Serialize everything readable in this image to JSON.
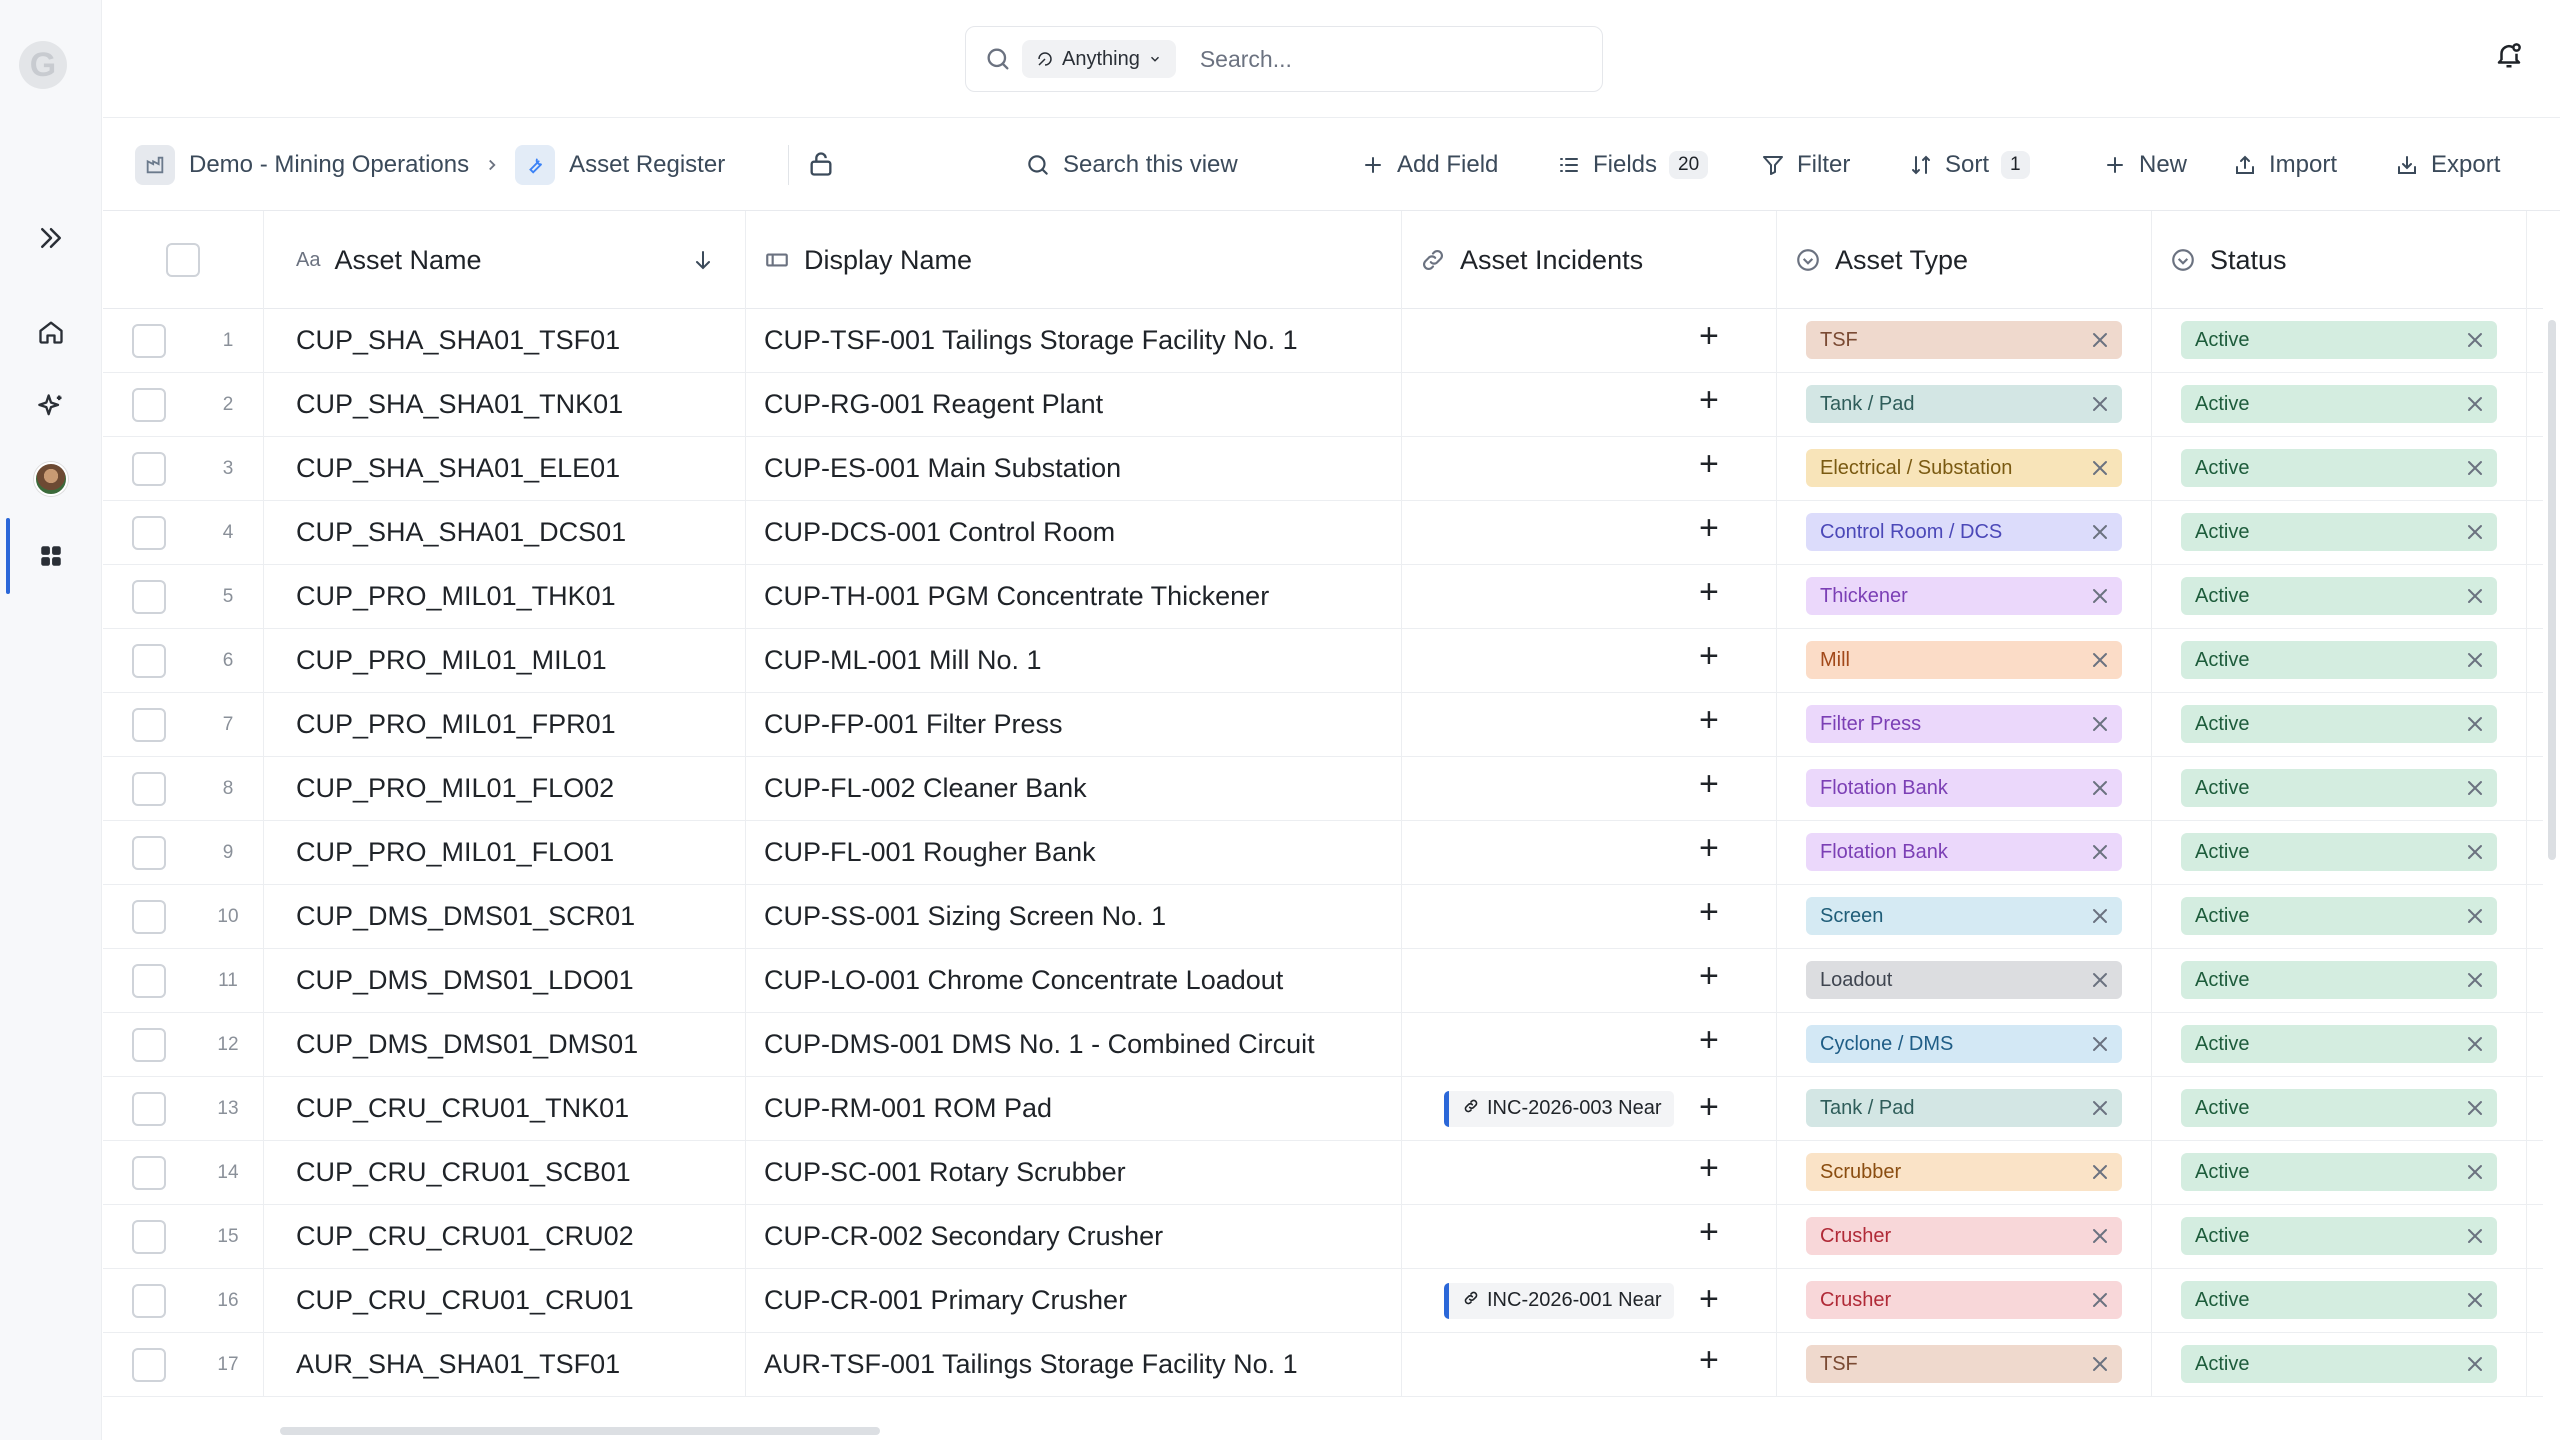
{
  "search": {
    "scope": "Anything",
    "placeholder": "Search..."
  },
  "breadcrumb": {
    "workspace": "Demo - Mining Operations",
    "table": "Asset Register"
  },
  "toolbar": {
    "search_view_placeholder": "Search this view",
    "add_field": "Add Field",
    "fields": "Fields",
    "fields_count": "20",
    "filter": "Filter",
    "sort": "Sort",
    "sort_count": "1",
    "new": "New",
    "import": "Import",
    "export": "Export"
  },
  "columns": {
    "asset_name": "Asset Name",
    "display_name": "Display Name",
    "asset_incidents": "Asset Incidents",
    "asset_type": "Asset Type",
    "status": "Status"
  },
  "colors": {
    "TSF": "#efd9cd",
    "Tank / Pad": "#d3e6e4",
    "Electrical / Substation": "#f8e4b9",
    "Control Room / DCS": "#dcdcfb",
    "Thickener": "#ebd8fb",
    "Mill": "#fbdcc7",
    "Filter Press": "#ebd8fb",
    "Flotation Bank": "#ebd8fb",
    "Screen": "#d5eaf3",
    "Loadout": "#dcdde0",
    "Cyclone / DMS": "#d3e8f5",
    "Scrubber": "#fae3c7",
    "Crusher": "#f8d7d9",
    "Active": "#d4ede0"
  },
  "rows": [
    {
      "n": "1",
      "asset": "CUP_SHA_SHA01_TSF01",
      "display": "CUP-TSF-001 Tailings Storage Facility No. 1",
      "incident": "",
      "type": "TSF",
      "status": "Active"
    },
    {
      "n": "2",
      "asset": "CUP_SHA_SHA01_TNK01",
      "display": "CUP-RG-001 Reagent Plant",
      "incident": "",
      "type": "Tank / Pad",
      "status": "Active"
    },
    {
      "n": "3",
      "asset": "CUP_SHA_SHA01_ELE01",
      "display": "CUP-ES-001 Main Substation",
      "incident": "",
      "type": "Electrical / Substation",
      "status": "Active"
    },
    {
      "n": "4",
      "asset": "CUP_SHA_SHA01_DCS01",
      "display": "CUP-DCS-001 Control Room",
      "incident": "",
      "type": "Control Room / DCS",
      "status": "Active"
    },
    {
      "n": "5",
      "asset": "CUP_PRO_MIL01_THK01",
      "display": "CUP-TH-001 PGM Concentrate Thickener",
      "incident": "",
      "type": "Thickener",
      "status": "Active"
    },
    {
      "n": "6",
      "asset": "CUP_PRO_MIL01_MIL01",
      "display": "CUP-ML-001 Mill No. 1",
      "incident": "",
      "type": "Mill",
      "status": "Active"
    },
    {
      "n": "7",
      "asset": "CUP_PRO_MIL01_FPR01",
      "display": "CUP-FP-001 Filter Press",
      "incident": "",
      "type": "Filter Press",
      "status": "Active"
    },
    {
      "n": "8",
      "asset": "CUP_PRO_MIL01_FLO02",
      "display": "CUP-FL-002 Cleaner Bank",
      "incident": "",
      "type": "Flotation Bank",
      "status": "Active"
    },
    {
      "n": "9",
      "asset": "CUP_PRO_MIL01_FLO01",
      "display": "CUP-FL-001 Rougher Bank",
      "incident": "",
      "type": "Flotation Bank",
      "status": "Active"
    },
    {
      "n": "10",
      "asset": "CUP_DMS_DMS01_SCR01",
      "display": "CUP-SS-001 Sizing Screen No. 1",
      "incident": "",
      "type": "Screen",
      "status": "Active"
    },
    {
      "n": "11",
      "asset": "CUP_DMS_DMS01_LDO01",
      "display": "CUP-LO-001 Chrome Concentrate Loadout",
      "incident": "",
      "type": "Loadout",
      "status": "Active"
    },
    {
      "n": "12",
      "asset": "CUP_DMS_DMS01_DMS01",
      "display": "CUP-DMS-001 DMS No. 1 - Combined Circuit",
      "incident": "",
      "type": "Cyclone / DMS",
      "status": "Active"
    },
    {
      "n": "13",
      "asset": "CUP_CRU_CRU01_TNK01",
      "display": "CUP-RM-001 ROM Pad",
      "incident": "INC-2026-003 Near",
      "type": "Tank / Pad",
      "status": "Active"
    },
    {
      "n": "14",
      "asset": "CUP_CRU_CRU01_SCB01",
      "display": "CUP-SC-001 Rotary Scrubber",
      "incident": "",
      "type": "Scrubber",
      "status": "Active"
    },
    {
      "n": "15",
      "asset": "CUP_CRU_CRU01_CRU02",
      "display": "CUP-CR-002 Secondary Crusher",
      "incident": "",
      "type": "Crusher",
      "status": "Active"
    },
    {
      "n": "16",
      "asset": "CUP_CRU_CRU01_CRU01",
      "display": "CUP-CR-001 Primary Crusher",
      "incident": "INC-2026-001 Near",
      "type": "Crusher",
      "status": "Active"
    },
    {
      "n": "17",
      "asset": "AUR_SHA_SHA01_TSF01",
      "display": "AUR-TSF-001 Tailings Storage Facility No. 1",
      "incident": "",
      "type": "TSF",
      "status": "Active"
    }
  ]
}
